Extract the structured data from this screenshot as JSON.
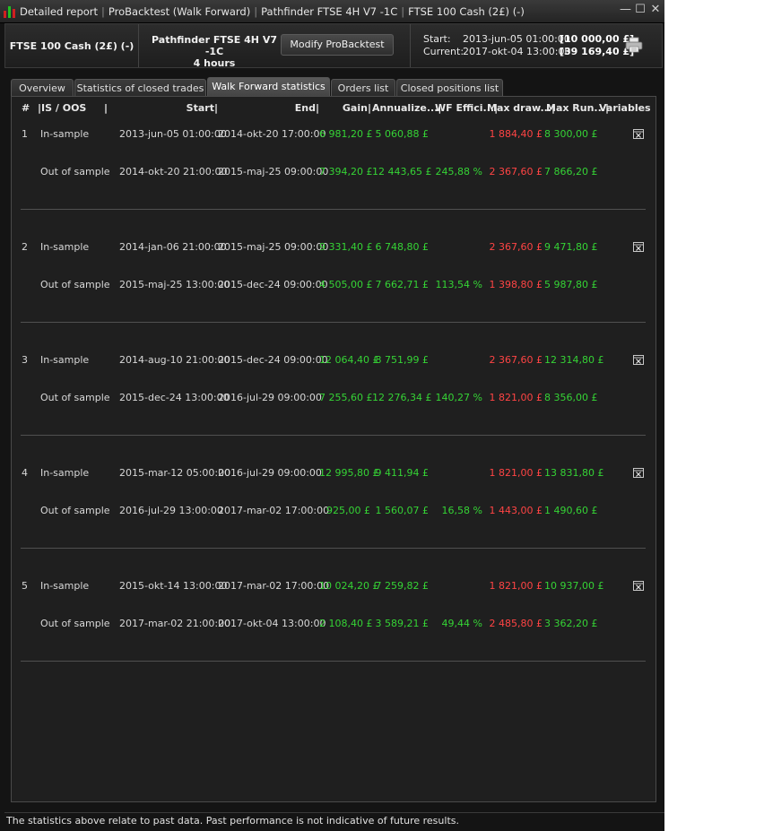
{
  "titlebar": {
    "parts": [
      "Detailed report",
      "ProBacktest (Walk Forward)",
      "Pathfinder FTSE 4H V7 -1C",
      "FTSE 100 Cash (2£) (-)"
    ],
    "minimize": "—",
    "maximize": "☐",
    "close": "✕"
  },
  "header": {
    "instrument": "FTSE 100 Cash (2£) (-)",
    "system_name": "Pathfinder FTSE 4H V7 -1C",
    "timeframe": "4 hours",
    "modify_label": "Modify ProBacktest",
    "start_label": "Start:",
    "start_date": "2013-jun-05 01:00:00",
    "start_value": "[10 000,00 £]",
    "current_label": "Current:",
    "current_date": "2017-okt-04 13:00:00",
    "current_value": "[39 169,40 £]"
  },
  "tabs": [
    "Overview",
    "Statistics of closed trades",
    "Walk Forward statistics",
    "Orders list",
    "Closed positions list"
  ],
  "active_tab": "Walk Forward statistics",
  "columns": {
    "num": "#",
    "isoos": "IS / OOS",
    "start": "Start",
    "end": "End",
    "gain": "Gain",
    "annualized": "Annualize...",
    "wfe": "WF Effici...",
    "maxdd": "Max draw...",
    "maxrunup": "Max Run...",
    "variables": "Variables"
  },
  "groups": [
    {
      "num": "1",
      "is": {
        "label": "In-sample",
        "start": "2013-jun-05 01:00:00",
        "end": "2014-okt-20 17:00:00",
        "gain": "6 981,20 £",
        "annualized": "5 060,88 £",
        "wfe": "",
        "maxdd": "1 884,40 £",
        "maxrunup": "8 300,00 £"
      },
      "oos": {
        "label": "Out of sample",
        "start": "2014-okt-20 21:00:00",
        "end": "2015-maj-25 09:00:00",
        "gain": "7 394,20 £",
        "annualized": "12 443,65 £",
        "wfe": "245,88 %",
        "maxdd": "2 367,60 £",
        "maxrunup": "7 866,20 £"
      }
    },
    {
      "num": "2",
      "is": {
        "label": "In-sample",
        "start": "2014-jan-06 21:00:00",
        "end": "2015-maj-25 09:00:00",
        "gain": "9 331,40 £",
        "annualized": "6 748,80 £",
        "wfe": "",
        "maxdd": "2 367,60 £",
        "maxrunup": "9 471,80 £"
      },
      "oos": {
        "label": "Out of sample",
        "start": "2015-maj-25 13:00:00",
        "end": "2015-dec-24 09:00:00",
        "gain": "4 505,00 £",
        "annualized": "7 662,71 £",
        "wfe": "113,54 %",
        "maxdd": "1 398,80 £",
        "maxrunup": "5 987,80 £"
      }
    },
    {
      "num": "3",
      "is": {
        "label": "In-sample",
        "start": "2014-aug-10 21:00:00",
        "end": "2015-dec-24 09:00:00",
        "gain": "12 064,40 £",
        "annualized": "8 751,99 £",
        "wfe": "",
        "maxdd": "2 367,60 £",
        "maxrunup": "12 314,80 £"
      },
      "oos": {
        "label": "Out of sample",
        "start": "2015-dec-24 13:00:00",
        "end": "2016-jul-29 09:00:00",
        "gain": "7 255,60 £",
        "annualized": "12 276,34 £",
        "wfe": "140,27 %",
        "maxdd": "1 821,00 £",
        "maxrunup": "8 356,00 £"
      }
    },
    {
      "num": "4",
      "is": {
        "label": "In-sample",
        "start": "2015-mar-12 05:00:00",
        "end": "2016-jul-29 09:00:00",
        "gain": "12 995,80 £",
        "annualized": "9 411,94 £",
        "wfe": "",
        "maxdd": "1 821,00 £",
        "maxrunup": "13 831,80 £"
      },
      "oos": {
        "label": "Out of sample",
        "start": "2016-jul-29 13:00:00",
        "end": "2017-mar-02 17:00:00",
        "gain": "925,00 £",
        "annualized": "1 560,07 £",
        "wfe": "16,58 %",
        "maxdd": "1 443,00 £",
        "maxrunup": "1 490,60 £"
      }
    },
    {
      "num": "5",
      "is": {
        "label": "In-sample",
        "start": "2015-okt-14 13:00:00",
        "end": "2017-mar-02 17:00:00",
        "gain": "10 024,20 £",
        "annualized": "7 259,82 £",
        "wfe": "",
        "maxdd": "1 821,00 £",
        "maxrunup": "10 937,00 £"
      },
      "oos": {
        "label": "Out of sample",
        "start": "2017-mar-02 21:00:00",
        "end": "2017-okt-04 13:00:00",
        "gain": "2 108,40 £",
        "annualized": "3 589,21 £",
        "wfe": "49,44 %",
        "maxdd": "2 485,80 £",
        "maxrunup": "3 362,20 £"
      }
    }
  ],
  "footer": "The statistics above relate to past data. Past performance is not indicative of future results.",
  "colors": {
    "gain": "#35d335",
    "loss": "#ff4444",
    "background": "#1f1f1f"
  }
}
